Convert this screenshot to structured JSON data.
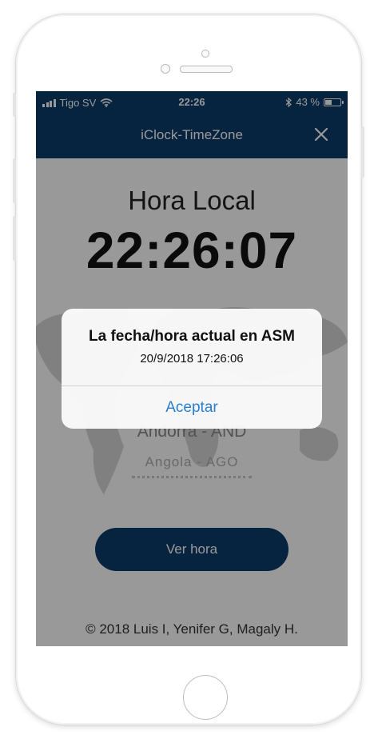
{
  "status_bar": {
    "carrier": "Tigo SV",
    "time": "22:26",
    "battery_text": "43 %",
    "battery_level": 0.43,
    "icons": [
      "signal-bars-icon",
      "wifi-icon",
      "bluetooth-icon",
      "battery-icon"
    ]
  },
  "nav": {
    "title": "iClock-TimeZone",
    "close_icon": "close-icon"
  },
  "main": {
    "local_label": "Hora Local",
    "clock_time": "22:26:07",
    "picker_items": [
      "Andorra - AND",
      "Angola - AGO"
    ],
    "ver_hora_label": "Ver hora",
    "footer": "© 2018 Luis I, Yenifer G, Magaly H."
  },
  "alert": {
    "title": "La fecha/hora actual en ASM",
    "message": "20/9/2018 17:26:06",
    "action_label": "Aceptar"
  },
  "colors": {
    "brand_navy": "#0b3d6a",
    "alert_action_blue": "#2a7ed1",
    "overlay": "rgba(0,0,0,0.40)"
  }
}
